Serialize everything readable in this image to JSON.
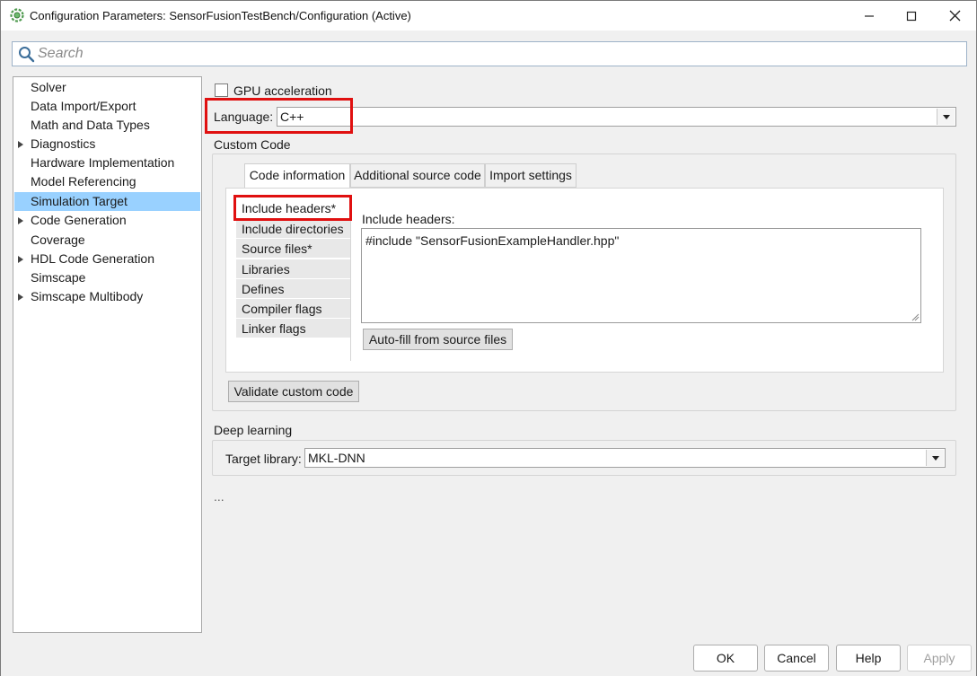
{
  "window": {
    "title": "Configuration Parameters: SensorFusionTestBench/Configuration (Active)"
  },
  "search": {
    "placeholder": "Search",
    "value": ""
  },
  "tree": {
    "items": [
      {
        "label": "Solver",
        "expandable": false,
        "selected": false
      },
      {
        "label": "Data Import/Export",
        "expandable": false,
        "selected": false
      },
      {
        "label": "Math and Data Types",
        "expandable": false,
        "selected": false
      },
      {
        "label": "Diagnostics",
        "expandable": true,
        "selected": false
      },
      {
        "label": "Hardware Implementation",
        "expandable": false,
        "selected": false
      },
      {
        "label": "Model Referencing",
        "expandable": false,
        "selected": false
      },
      {
        "label": "Simulation Target",
        "expandable": false,
        "selected": true
      },
      {
        "label": "Code Generation",
        "expandable": true,
        "selected": false
      },
      {
        "label": "Coverage",
        "expandable": false,
        "selected": false
      },
      {
        "label": "HDL Code Generation",
        "expandable": true,
        "selected": false
      },
      {
        "label": "Simscape",
        "expandable": false,
        "selected": false
      },
      {
        "label": "Simscape Multibody",
        "expandable": true,
        "selected": false
      }
    ]
  },
  "panel": {
    "gpu_label": "GPU acceleration",
    "gpu_checked": false,
    "language_label": "Language:",
    "language_value": "C++",
    "custom_code_label": "Custom Code",
    "tabs": [
      "Code information",
      "Additional source code",
      "Import settings"
    ],
    "active_tab": 0,
    "side_tabs": [
      "Include headers*",
      "Include directories",
      "Source files*",
      "Libraries",
      "Defines",
      "Compiler flags",
      "Linker flags"
    ],
    "active_side_tab": 0,
    "include_headers_label": "Include headers:",
    "include_headers_value": "#include \"SensorFusionExampleHandler.hpp\"",
    "autofill_button": "Auto-fill from source files",
    "validate_button": "Validate custom code",
    "deep_learning_label": "Deep learning",
    "target_library_label": "Target library:",
    "target_library_value": "MKL-DNN",
    "ellipsis": "..."
  },
  "footer": {
    "ok": "OK",
    "cancel": "Cancel",
    "help": "Help",
    "apply": "Apply"
  },
  "colors": {
    "selection": "#99d1ff",
    "highlight": "#e01010",
    "background": "#f0f0f0"
  }
}
